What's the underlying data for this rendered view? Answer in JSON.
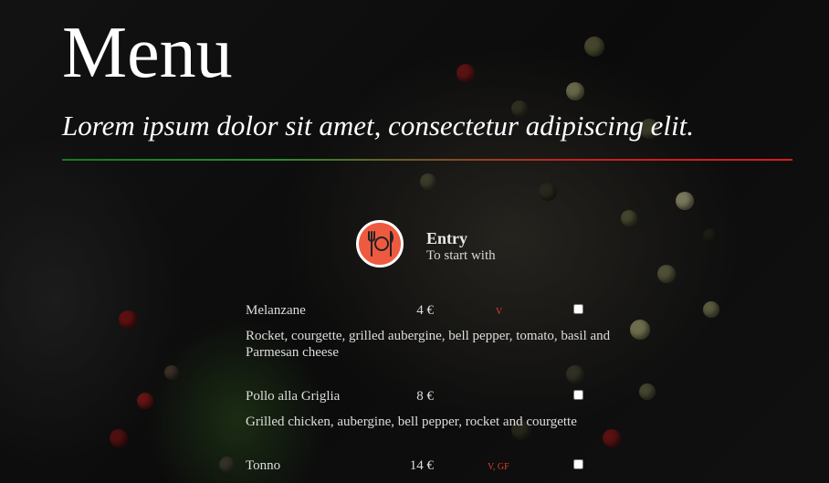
{
  "header": {
    "title": "Menu",
    "subtitle": "Lorem ipsum dolor sit amet, consectetur adipiscing elit."
  },
  "category": {
    "icon": "fork-knife-plate-icon",
    "title": "Entry",
    "subtitle": "To start with",
    "icon_bg": "#ee5a40"
  },
  "items": [
    {
      "name": "Melanzane",
      "price": "4 €",
      "tag": "V",
      "description": "Rocket, courgette, grilled aubergine, bell pepper, tomato, basil and Parmesan cheese",
      "checked": false
    },
    {
      "name": "Pollo alla Griglia",
      "price": "8 €",
      "tag": "",
      "description": "Grilled chicken, aubergine, bell pepper, rocket and courgette",
      "checked": false
    },
    {
      "name": "Tonno",
      "price": "14 €",
      "tag": "V, GF",
      "description": "",
      "checked": false
    }
  ],
  "colors": {
    "divider_start": "#1a7a1a",
    "divider_end": "#d41f1f",
    "tag": "#d9412b"
  }
}
